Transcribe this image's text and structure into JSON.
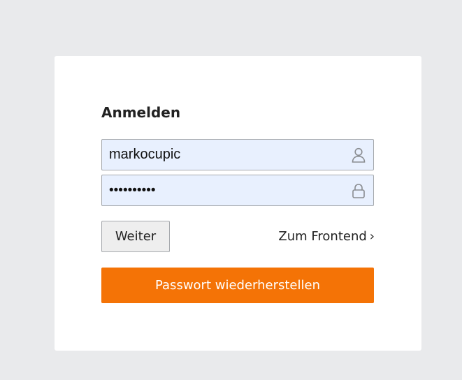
{
  "login": {
    "title": "Anmelden",
    "username": {
      "value": "markocupic",
      "icon": "user-icon"
    },
    "password": {
      "value": "••••••••••",
      "icon": "lock-icon"
    },
    "submit_label": "Weiter",
    "frontend_link": {
      "label": "Zum Frontend",
      "chevron": "›"
    },
    "reset_label": "Passwort wiederherstellen"
  },
  "colors": {
    "page_background": "#e9eaec",
    "card_background": "#ffffff",
    "autofill_background": "#e8f0fe",
    "accent": "#f47306"
  }
}
